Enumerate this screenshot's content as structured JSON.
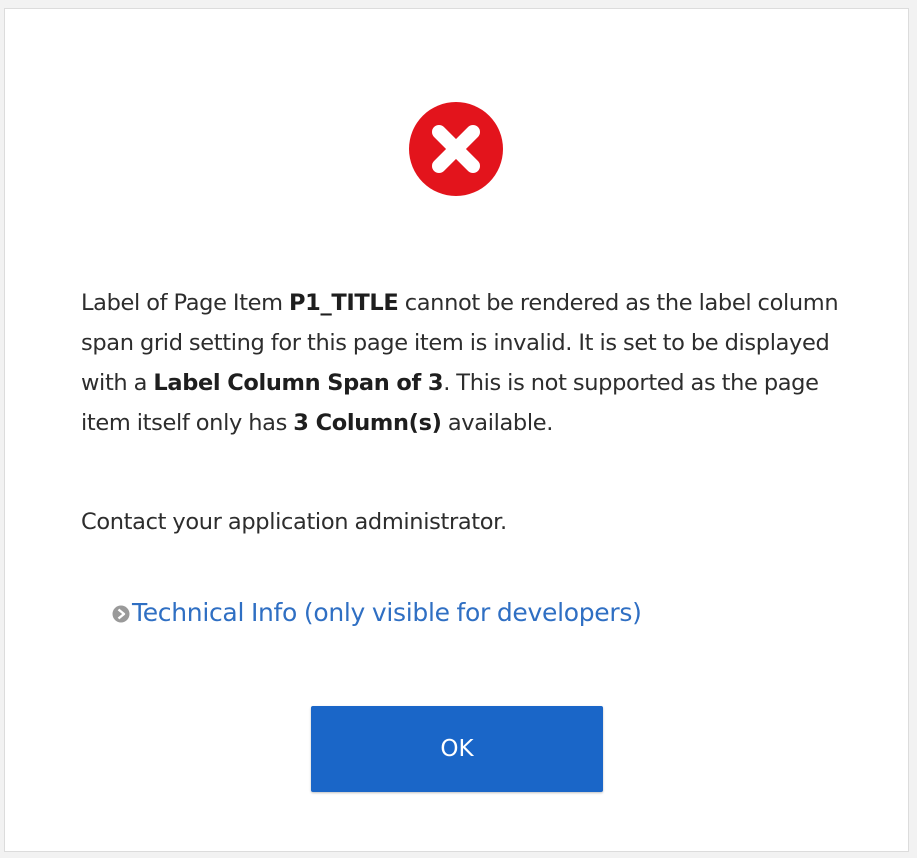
{
  "dialog": {
    "message": {
      "part1": "Label of Page Item ",
      "item_name": "P1_TITLE",
      "part2": " cannot be rendered as the label column span grid setting for this page item is invalid. It is set to be displayed with a ",
      "span_setting": "Label Column Span of 3",
      "part3": ". This is not supported as the page item itself only has ",
      "columns": "3 Column(s)",
      "part4": " available."
    },
    "contact_text": "Contact your application administrator.",
    "technical_info_label": "Technical Info (only visible for developers)",
    "ok_label": "OK",
    "icons": {
      "error": "error-circle-x-icon",
      "expand": "expand-arrow-icon"
    },
    "colors": {
      "error_red": "#e3141c",
      "link_blue": "#2f6fc3",
      "button_blue": "#1a66c8"
    }
  }
}
